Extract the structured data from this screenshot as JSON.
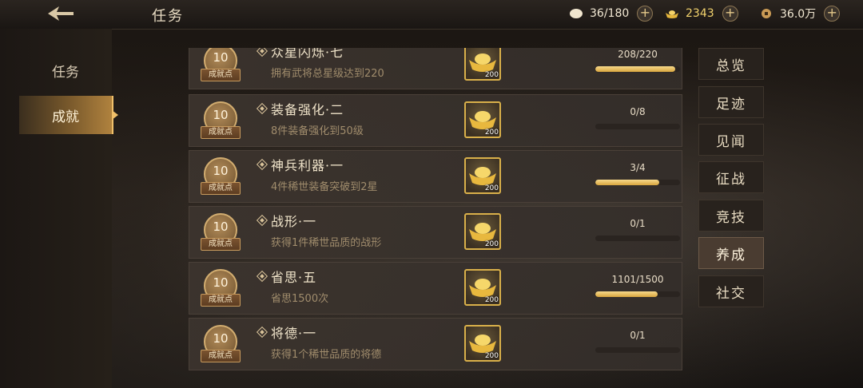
{
  "header": {
    "title": "任务"
  },
  "resources": [
    {
      "icon": "egg-icon",
      "value": "36/180"
    },
    {
      "icon": "gold-ingot-icon",
      "value": "2343"
    },
    {
      "icon": "coin-icon",
      "value": "36.0万"
    }
  ],
  "sidebar": {
    "items": [
      {
        "label": "任务"
      },
      {
        "label": "成就"
      }
    ],
    "active": "成就"
  },
  "achievements": [
    {
      "points": "10",
      "points_label": "成就点",
      "title": "众星闪烁·七",
      "desc": "拥有武将总星级达到220",
      "reward_qty": "200",
      "progress": "208/220",
      "ratio": 0.945
    },
    {
      "points": "10",
      "points_label": "成就点",
      "title": "装备强化·二",
      "desc": "8件装备强化到50级",
      "reward_qty": "200",
      "progress": "0/8",
      "ratio": 0
    },
    {
      "points": "10",
      "points_label": "成就点",
      "title": "神兵利器·一",
      "desc": "4件稀世装备突破到2星",
      "reward_qty": "200",
      "progress": "3/4",
      "ratio": 0.75
    },
    {
      "points": "10",
      "points_label": "成就点",
      "title": "战形·一",
      "desc": "获得1件稀世品质的战形",
      "reward_qty": "200",
      "progress": "0/1",
      "ratio": 0
    },
    {
      "points": "10",
      "points_label": "成就点",
      "title": "省思·五",
      "desc": "省思1500次",
      "reward_qty": "200",
      "progress": "1101/1500",
      "ratio": 0.734
    },
    {
      "points": "10",
      "points_label": "成就点",
      "title": "将德·一",
      "desc": "获得1个稀世品质的将德",
      "reward_qty": "200",
      "progress": "0/1",
      "ratio": 0
    }
  ],
  "tabs": [
    {
      "label": "总览"
    },
    {
      "label": "足迹"
    },
    {
      "label": "见闻"
    },
    {
      "label": "征战"
    },
    {
      "label": "竞技"
    },
    {
      "label": "养成"
    },
    {
      "label": "社交"
    }
  ],
  "active_tab": "养成",
  "colors": {
    "accent": "#d9a63e",
    "panel": "#3c342e"
  }
}
